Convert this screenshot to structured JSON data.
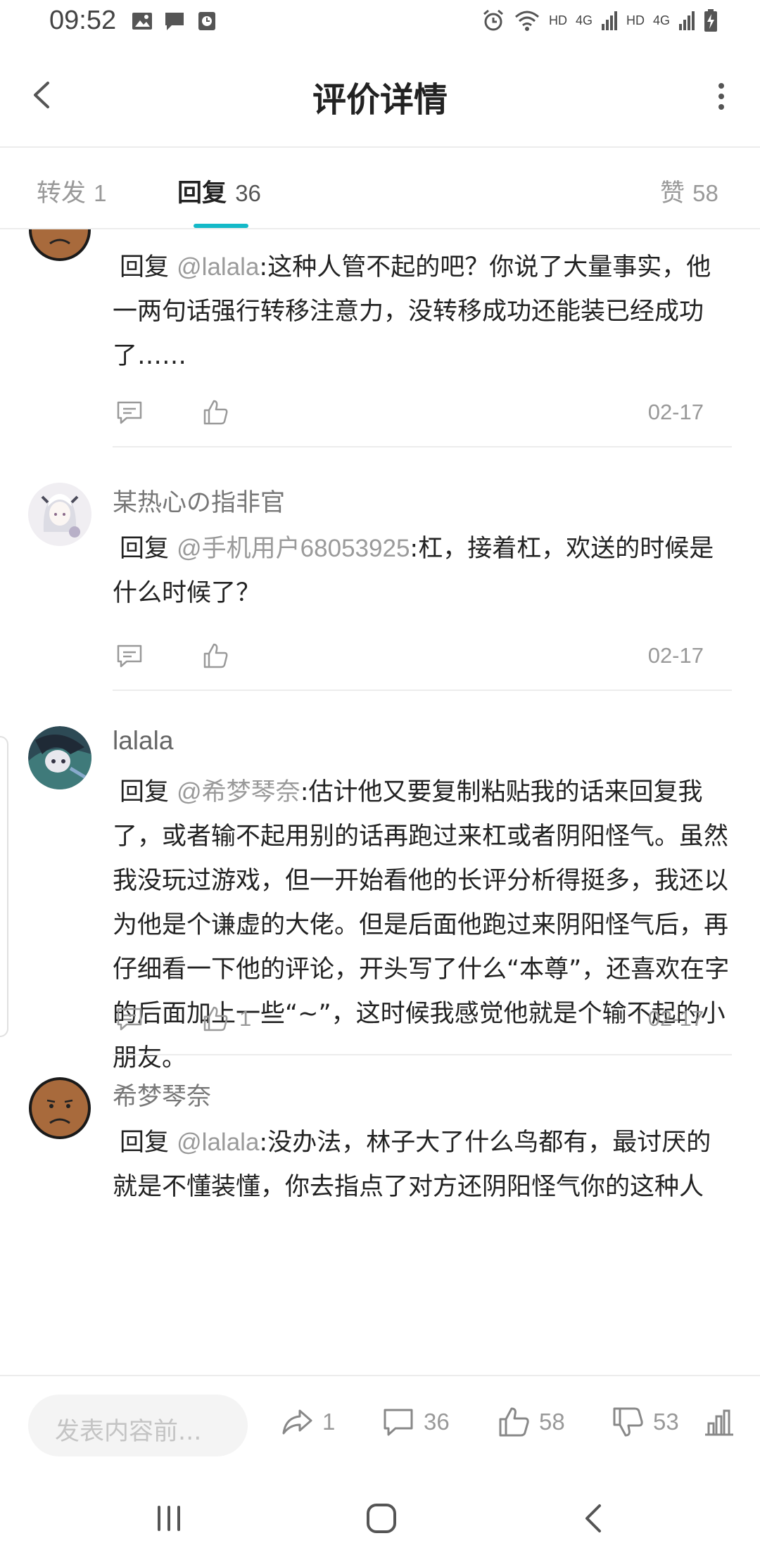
{
  "status_bar": {
    "time": "09:52",
    "left_icons": [
      "image-icon",
      "message-icon",
      "clock-app-icon"
    ],
    "right_icons": [
      "alarm-icon",
      "wifi-icon",
      "hd-4g-signal-icon",
      "hd-4g-signal-icon",
      "battery-charging-icon"
    ],
    "net_labels": [
      "HD",
      "4G",
      "HD",
      "4G"
    ]
  },
  "header": {
    "title": "评价详情",
    "back_icon": "back-chevron-icon",
    "more_icon": "more-vertical-icon"
  },
  "tabs": [
    {
      "label": "转发",
      "count": "1",
      "active": false
    },
    {
      "label": "回复",
      "count": "36",
      "active": true
    },
    {
      "label": "赞",
      "count": "58",
      "active": false
    }
  ],
  "comments": [
    {
      "name": "",
      "avatar": "sad-face-avatar",
      "reply_word": "回复",
      "mention": "@lalala",
      "text": ":这种人管不起的吧？你说了大量事实，他一两句话强行转移注意力，没转移成功还能装已经成功了……",
      "likes": "",
      "date": "02-17"
    },
    {
      "name": "某热心の指非官",
      "avatar": "anime-girl-avatar",
      "reply_word": "回复",
      "mention": "@手机用户68053925",
      "text": ":杠，接着杠，欢送的时候是什么时候了？",
      "likes": "",
      "date": "02-17"
    },
    {
      "name": "lalala",
      "avatar": "anime-character-avatar",
      "reply_word": "回复",
      "mention": "@希梦琴奈",
      "text": ":估计他又要复制粘贴我的话来回复我了，或者输不起用别的话再跑过来杠或者阴阳怪气。虽然我没玩过游戏，但一开始看他的长评分析得挺多，我还以为他是个谦虚的大佬。但是后面他跑过来阴阳怪气后，再仔细看一下他的评论，开头写了什么“本尊”，还喜欢在字的后面加上一些“~”，这时候我感觉他就是个输不起的小朋友。",
      "likes": "1",
      "date": "02-17"
    },
    {
      "name": "希梦琴奈",
      "avatar": "sad-face-avatar",
      "reply_word": "回复",
      "mention": "@lalala",
      "text": ":没办法，林子大了什么鸟都有，最讨厌的就是不懂装懂，你去指点了对方还阴阳怪气你的这种人",
      "likes": "",
      "date": ""
    }
  ],
  "bottom_bar": {
    "compose_placeholder": "发表内容前...",
    "repost_count": "1",
    "comment_count": "36",
    "like_count": "58",
    "dislike_count": "53",
    "stats_icon": "bar-chart-icon"
  },
  "nav_bar": {
    "icons": [
      "recent-apps-icon",
      "home-icon",
      "back-icon"
    ]
  },
  "colors": {
    "accent": "#14b9c8",
    "text_primary": "#222222",
    "text_secondary": "#999999",
    "mention": "#9a9a9a",
    "divider": "#ececec"
  }
}
